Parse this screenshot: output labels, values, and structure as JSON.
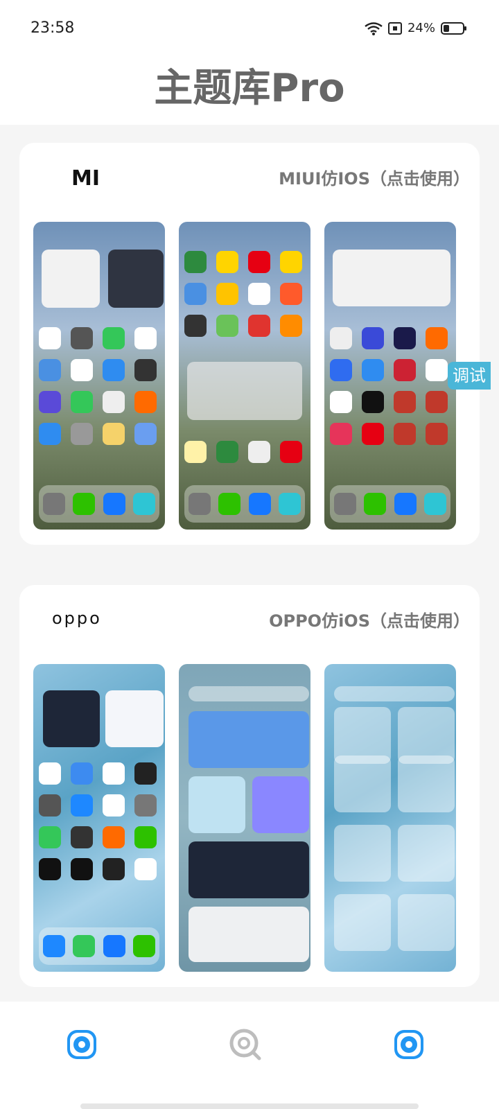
{
  "status": {
    "time": "23:58",
    "battery": "24%"
  },
  "app": {
    "title": "主题库Pro"
  },
  "cards": [
    {
      "brand": "MI",
      "label": "MIUI仿IOS（点击使用）",
      "style": "miui"
    },
    {
      "brand": "oppo",
      "label": "OPPO仿iOS（点击使用）",
      "style": "oppo"
    }
  ],
  "debug": {
    "label": "调试"
  },
  "colors": {
    "accent": "#2196f3",
    "nav_inactive": "#bdbdbd",
    "debug_tab": "#4ab6d8"
  },
  "icons": {
    "nav_left": "theme-icon",
    "nav_center": "search-icon",
    "nav_right": "theme-icon"
  }
}
